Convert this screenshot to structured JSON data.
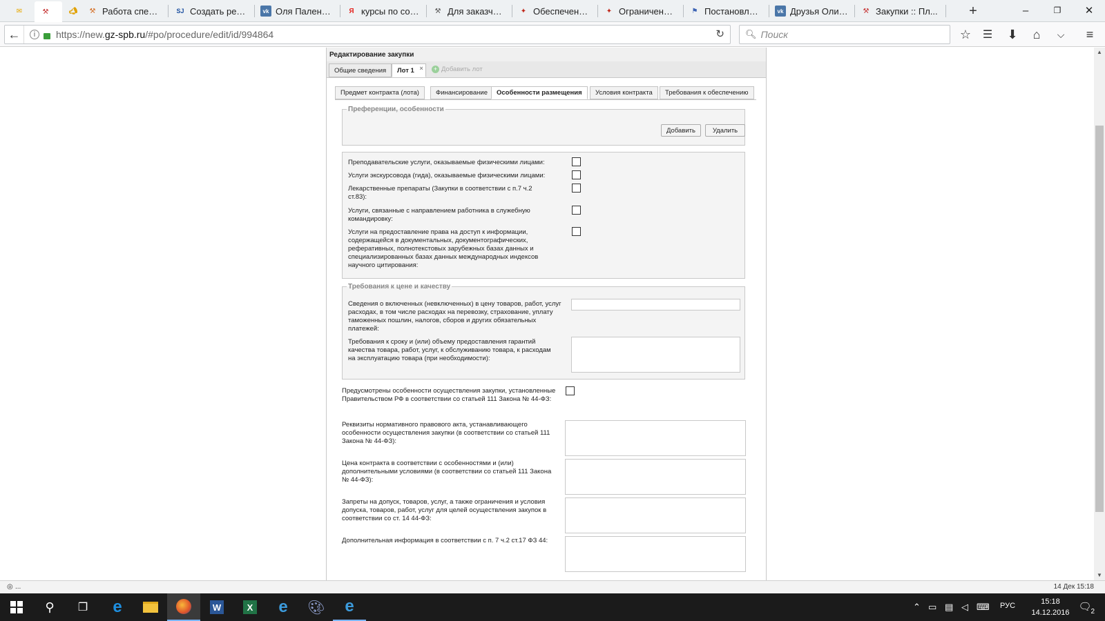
{
  "browser": {
    "tabs": [
      {
        "title": "",
        "favicon": "mail-icon",
        "color": "#e8a800"
      },
      {
        "title": "",
        "favicon": "hammer-icon",
        "color": "#c53030",
        "active": true
      },
      {
        "title": "",
        "favicon": "megaphone-icon",
        "color": "#e0a000"
      },
      {
        "title": "Работа специ...",
        "favicon": "hammer-icon",
        "color": "#d46b1f"
      },
      {
        "title": "Создать резю...",
        "favicon": "sj-logo-icon",
        "color": "#1c4fa0"
      },
      {
        "title": "Оля Паленова",
        "favicon": "vk-icon",
        "color": "#4a76a8"
      },
      {
        "title": "курсы по сост...",
        "favicon": "yandex-icon",
        "color": "#e52620"
      },
      {
        "title": "Для заказчик...",
        "favicon": "hammer-icon",
        "color": "#555555"
      },
      {
        "title": "Обеспечение ...",
        "favicon": "emblem-icon",
        "color": "#c0281b"
      },
      {
        "title": "Ограничение ...",
        "favicon": "emblem-icon",
        "color": "#c0281b"
      },
      {
        "title": "Постановлен...",
        "favicon": "flag-icon",
        "color": "#3c63b4"
      },
      {
        "title": "Друзья Оли П...",
        "favicon": "vk-icon",
        "color": "#4a76a8"
      },
      {
        "title": "Закупки :: Пл...",
        "favicon": "hammer-icon",
        "color": "#c53030"
      }
    ],
    "new_tab": "+",
    "url_prefix": "https://new.",
    "url_domain": "gz-spb.ru",
    "url_path": "/#po/procedure/edit/id/994864",
    "search_placeholder": "Поиск",
    "status_text": "...",
    "status_date": "14 Дек 15:18"
  },
  "form": {
    "title": "Редактирование закупки",
    "top_tabs": [
      "Общие сведения",
      "Лот 1"
    ],
    "add_lot": "Добавить лот",
    "sub_tabs": [
      "Предмет контракта (лота)",
      "Финансирование",
      "Особенности размещения",
      "Условия контракта",
      "Требования к обеспечению"
    ],
    "active_sub_tab": 2,
    "preferences": {
      "legend": "Преференции, особенности",
      "add_button": "Добавить",
      "delete_button": "Удалить"
    },
    "checkbox_items": [
      "Преподавательские услуги, оказываемые физическими лицами:",
      "Услуги экскурсовода (гида), оказываемые физическими лицами:",
      "Лекарственные препараты (Закупки в соответствии с п.7 ч.2 ст.83):",
      "Услуги, связанные с направлением работника в служебную командировку:",
      "Услуги на предоставление права на доступ к информации, содержащейся в документальных, документографических, реферативных, полнотекстовых зарубежных базах данных и специализированных базах данных международных индексов научного цитирования:"
    ],
    "price_quality": {
      "legend": "Требования к цене и качеству",
      "field1": "Сведения о включенных (невключенных) в цену товаров, работ, услуг расходах, в том числе расходах на перевозку, страхование, уплату таможенных пошлин, налогов, сборов и других обязательных платежей:",
      "field2": "Требования к сроку и (или) объему предоставления гарантий качества товара, работ, услуг, к обслуживанию товара, к расходам на эксплуатацию товара (при необходимости):"
    },
    "special": {
      "checkbox_label": "Предусмотрены особенности осуществления закупки, установленные Правительством РФ в соответствии со статьей 111 Закона № 44-ФЗ:",
      "fields": [
        "Реквизиты нормативного правового акта, устанавливающего особенности осуществления закупки (в соответствии со статьей 111 Закона № 44-ФЗ):",
        "Цена контракта в соответствии с особенностями и (или) дополнительными условиями (в соответствии со статьей 111 Закона № 44-ФЗ):",
        "Запреты на допуск, товаров, услуг, а также ограничения и условия допуска, товаров, работ, услуг для целей осуществления закупок в соответствии со ст. 14 44-ФЗ:",
        "Дополнительная информация в соответствии с п. 7 ч.2 ст.17 ФЗ 44:"
      ]
    }
  },
  "taskbar": {
    "lang": "РУС",
    "time": "15:18",
    "date": "14.12.2016",
    "notifications": "2"
  }
}
